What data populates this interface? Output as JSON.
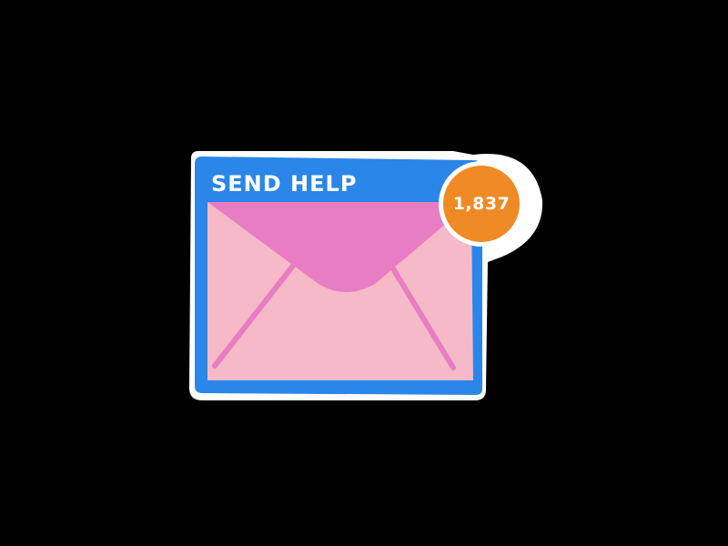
{
  "window": {
    "title": "SEND HELP"
  },
  "notification": {
    "count": "1,837"
  },
  "icon": {
    "name": "envelope-icon"
  },
  "colors": {
    "background": "#000000",
    "frame_blue": "#2a86e8",
    "envelope_body": "#f5b9c8",
    "envelope_flap": "#e87dc3",
    "badge_orange": "#f08a24",
    "outline_white": "#ffffff"
  }
}
